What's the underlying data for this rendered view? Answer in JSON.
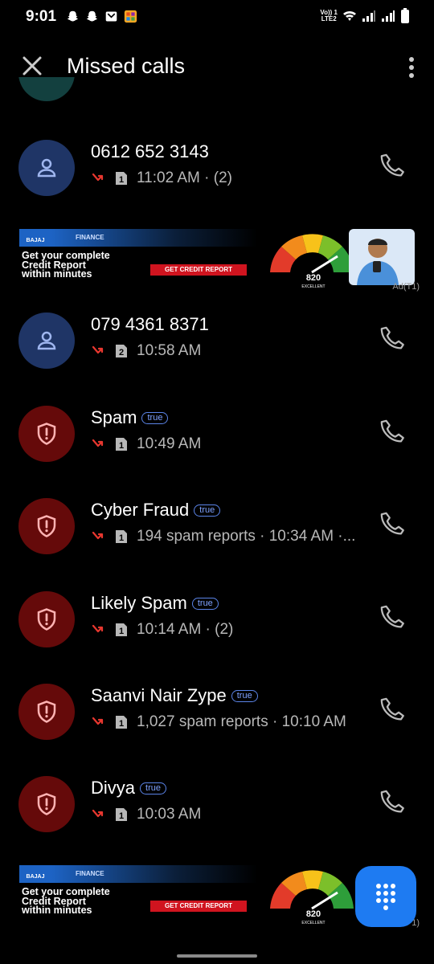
{
  "status_bar": {
    "time": "9:01",
    "volte_line1": "Vo)) 1",
    "volte_line2": "LTE2"
  },
  "app_bar": {
    "title": "Missed calls"
  },
  "calls": [
    {
      "name": "0612 652 3143",
      "badge": "",
      "sim": "1",
      "meta": "11:02 AM · (2)",
      "type": "contact"
    },
    {
      "name": "079 4361 8371",
      "badge": "",
      "sim": "2",
      "meta": "10:58 AM",
      "type": "contact"
    },
    {
      "name": "Spam",
      "badge": "true",
      "sim": "1",
      "meta": "10:49 AM",
      "type": "spam"
    },
    {
      "name": "Cyber Fraud",
      "badge": "true",
      "sim": "1",
      "meta": "194 spam reports · 10:34 AM ·...",
      "type": "spam"
    },
    {
      "name": "Likely Spam",
      "badge": "true",
      "sim": "1",
      "meta": "10:14 AM · (2)",
      "type": "spam"
    },
    {
      "name": "Saanvi Nair Zype",
      "badge": "true",
      "sim": "1",
      "meta": "1,027 spam reports · 10:10 AM",
      "type": "spam"
    },
    {
      "name": "Divya",
      "badge": "true",
      "sim": "1",
      "meta": "10:03 AM",
      "type": "spam"
    }
  ],
  "ads": [
    {
      "brand": "BAJAJ",
      "brand_sub": "FINANCE",
      "headline": "Get your complete\nCredit Report\nwithin minutes",
      "cta": "GET CREDIT REPORT",
      "score": "820",
      "score_label": "EXCELLENT",
      "tag": "Ad(T1)"
    },
    {
      "brand": "BAJAJ",
      "brand_sub": "FINANCE",
      "headline": "Get your complete\nCredit Report\nwithin minutes",
      "cta": "GET CREDIT REPORT",
      "score": "820",
      "score_label": "EXCELLENT",
      "tag": "1)"
    }
  ],
  "colors": {
    "contact_avatar": "#1f3566",
    "spam_avatar": "#650a0a",
    "missed_red": "#e8372f",
    "fab_blue": "#1e7bf2",
    "badge_blue": "#5b84e8"
  },
  "icons": {
    "close": "close-icon",
    "more": "more-vert-icon",
    "call": "phone-icon",
    "contact": "person-icon",
    "spam": "shield-alert-icon",
    "missed": "missed-call-icon",
    "dialpad": "dialpad-icon"
  }
}
